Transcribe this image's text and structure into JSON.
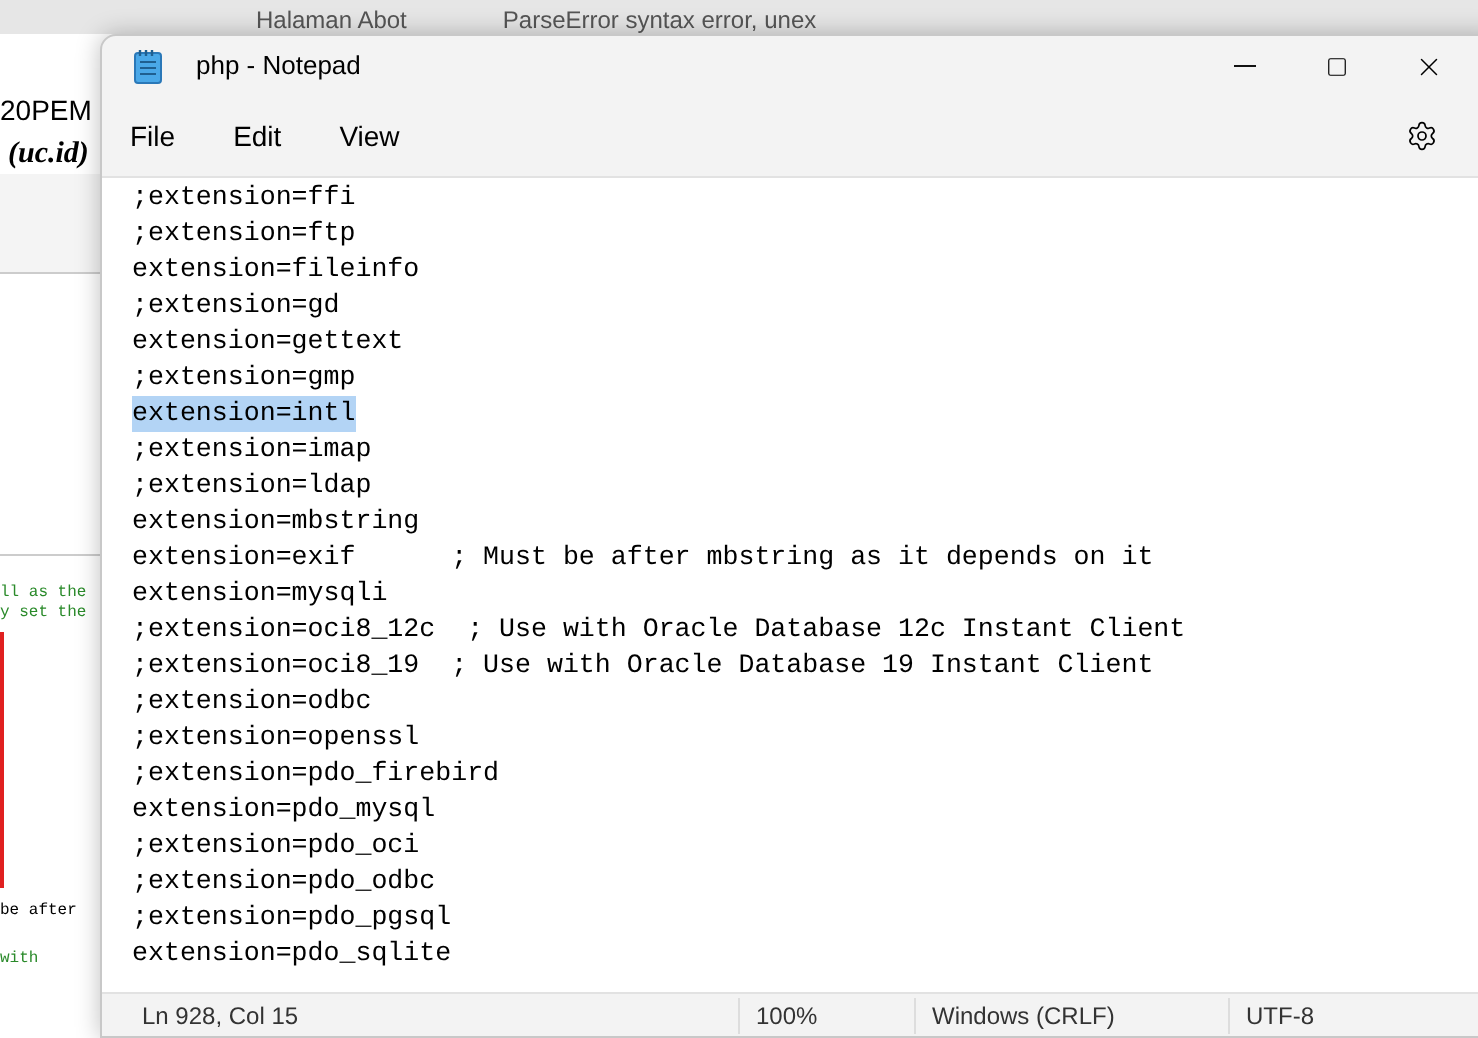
{
  "background": {
    "tabs": [
      {
        "label": "Halaman Abot",
        "selected": false
      },
      {
        "label": "ParseError syntax error, unex",
        "selected": false
      }
    ],
    "address_text": "20PEM",
    "heading_text": "(uc.id)",
    "code_lines": [
      "ll as the",
      "y set the",
      "be after",
      "with"
    ]
  },
  "window": {
    "title": "php - Notepad",
    "menu": [
      "File",
      "Edit",
      "View"
    ]
  },
  "editor": {
    "lines": [
      {
        "text": ";extension=ffi",
        "selected": false
      },
      {
        "text": ";extension=ftp",
        "selected": false
      },
      {
        "text": "extension=fileinfo",
        "selected": false
      },
      {
        "text": ";extension=gd",
        "selected": false
      },
      {
        "text": "extension=gettext",
        "selected": false
      },
      {
        "text": ";extension=gmp",
        "selected": false
      },
      {
        "text": "extension=intl",
        "selected": true
      },
      {
        "text": ";extension=imap",
        "selected": false
      },
      {
        "text": ";extension=ldap",
        "selected": false
      },
      {
        "text": "extension=mbstring",
        "selected": false
      },
      {
        "text": "extension=exif      ; Must be after mbstring as it depends on it",
        "selected": false
      },
      {
        "text": "extension=mysqli",
        "selected": false
      },
      {
        "text": ";extension=oci8_12c  ; Use with Oracle Database 12c Instant Client",
        "selected": false
      },
      {
        "text": ";extension=oci8_19  ; Use with Oracle Database 19 Instant Client",
        "selected": false
      },
      {
        "text": ";extension=odbc",
        "selected": false
      },
      {
        "text": ";extension=openssl",
        "selected": false
      },
      {
        "text": ";extension=pdo_firebird",
        "selected": false
      },
      {
        "text": "extension=pdo_mysql",
        "selected": false
      },
      {
        "text": ";extension=pdo_oci",
        "selected": false
      },
      {
        "text": ";extension=pdo_odbc",
        "selected": false
      },
      {
        "text": ";extension=pdo_pgsql",
        "selected": false
      },
      {
        "text": "extension=pdo_sqlite",
        "selected": false
      }
    ]
  },
  "status_bar": [
    "Ln 928, Col 15",
    "100%",
    "Windows (CRLF)",
    "UTF-8"
  ]
}
